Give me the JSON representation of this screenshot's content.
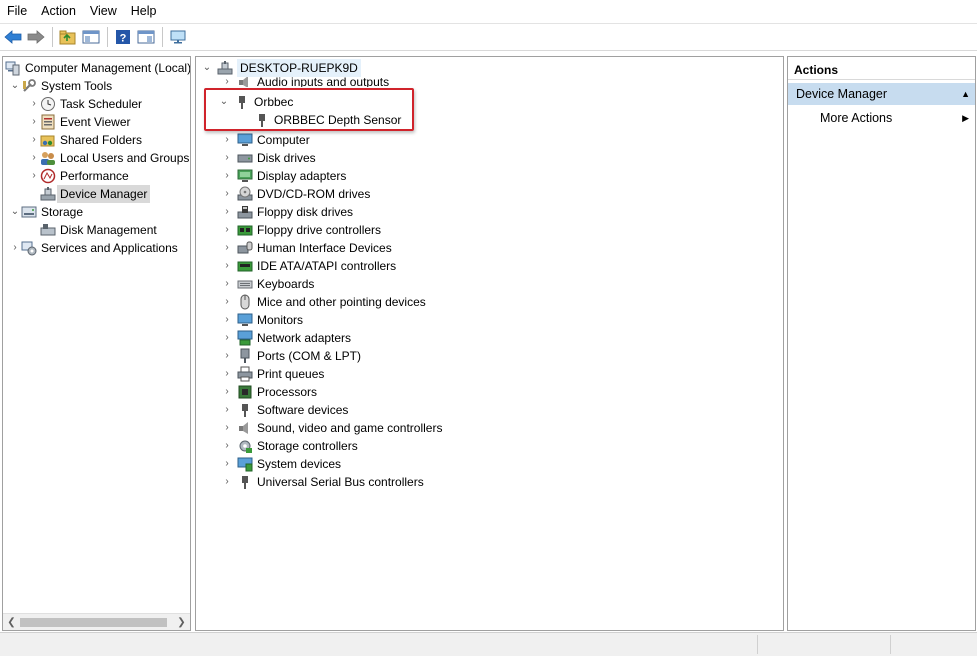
{
  "menu": [
    "File",
    "Action",
    "View",
    "Help"
  ],
  "left_tree": {
    "root": "Computer Management (Local)",
    "system_tools": "System Tools",
    "task_scheduler": "Task Scheduler",
    "event_viewer": "Event Viewer",
    "shared_folders": "Shared Folders",
    "local_users": "Local Users and Groups",
    "performance": "Performance",
    "device_manager": "Device Manager",
    "storage": "Storage",
    "disk_management": "Disk Management",
    "services": "Services and Applications"
  },
  "device_tree": {
    "computer_name": "DESKTOP-RUEPK9D",
    "audio": "Audio inputs and outputs",
    "orbbec": "Orbbec",
    "orbbec_sensor": "ORBBEC Depth Sensor",
    "categories": [
      "Computer",
      "Disk drives",
      "Display adapters",
      "DVD/CD-ROM drives",
      "Floppy disk drives",
      "Floppy drive controllers",
      "Human Interface Devices",
      "IDE ATA/ATAPI controllers",
      "Keyboards",
      "Mice and other pointing devices",
      "Monitors",
      "Network adapters",
      "Ports (COM & LPT)",
      "Print queues",
      "Processors",
      "Software devices",
      "Sound, video and game controllers",
      "Storage controllers",
      "System devices",
      "Universal Serial Bus controllers"
    ]
  },
  "actions": {
    "header": "Actions",
    "section": "Device Manager",
    "more": "More Actions"
  },
  "colors": {
    "highlight_box": "#d0232b",
    "section_bg": "#c7dcef"
  }
}
